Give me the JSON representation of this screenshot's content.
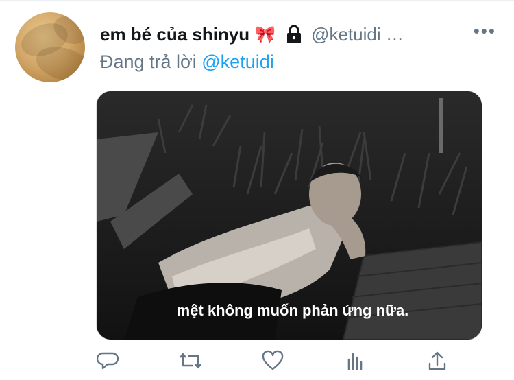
{
  "tweet": {
    "display_name": "em bé của shinyu",
    "name_emoji": "🎀",
    "handle": "@ketuidi …",
    "more_label": "•••",
    "reply": {
      "prefix": "Đang trả lời ",
      "mention": "@ketuidi"
    },
    "media": {
      "caption": "mệt không muốn phản ứng nữa."
    },
    "actions": [
      {
        "name": "reply",
        "icon": "speech-bubble-icon"
      },
      {
        "name": "retweet",
        "icon": "retweet-icon"
      },
      {
        "name": "like",
        "icon": "heart-icon"
      },
      {
        "name": "analytics",
        "icon": "bar-chart-icon"
      },
      {
        "name": "share",
        "icon": "share-icon"
      }
    ]
  },
  "colors": {
    "primary_text": "#14171a",
    "secondary_text": "#657786",
    "link": "#1da1f2",
    "icon": "#657786"
  }
}
